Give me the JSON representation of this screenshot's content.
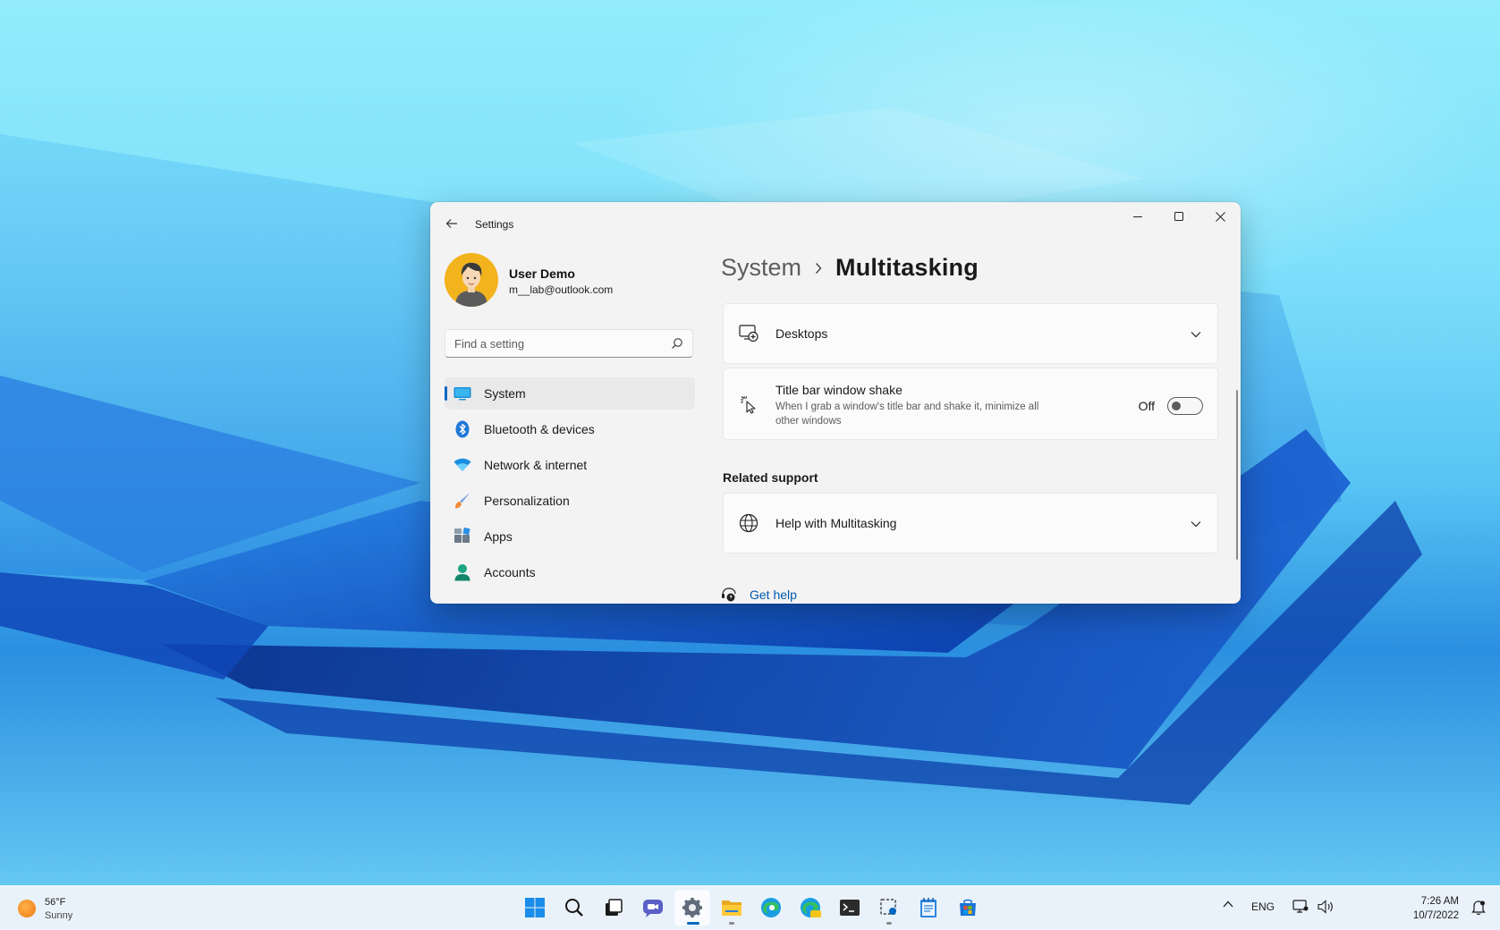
{
  "window": {
    "title": "Settings",
    "icons": {
      "back": "back-arrow-icon",
      "minimize": "minimize-icon",
      "maximize": "maximize-icon",
      "close": "close-icon"
    }
  },
  "profile": {
    "name": "User Demo",
    "email": "m__lab@outlook.com"
  },
  "search": {
    "placeholder": "Find a setting"
  },
  "nav": {
    "items": [
      {
        "label": "System",
        "icon": "system-icon",
        "active": true
      },
      {
        "label": "Bluetooth & devices",
        "icon": "bluetooth-icon"
      },
      {
        "label": "Network & internet",
        "icon": "wifi-icon"
      },
      {
        "label": "Personalization",
        "icon": "brush-icon"
      },
      {
        "label": "Apps",
        "icon": "apps-icon"
      },
      {
        "label": "Accounts",
        "icon": "accounts-icon"
      }
    ]
  },
  "content": {
    "breadcrumb": {
      "parent": "System",
      "current": "Multitasking"
    },
    "desktops": {
      "title": "Desktops"
    },
    "shake": {
      "title": "Title bar window shake",
      "description": "When I grab a window's title bar and shake it, minimize all other windows",
      "state_label": "Off",
      "enabled": false
    },
    "related_support": {
      "heading": "Related support",
      "help_title": "Help with Multitasking"
    },
    "get_help": "Get help"
  },
  "taskbar": {
    "weather": {
      "temp": "56°F",
      "condition": "Sunny"
    },
    "apps": [
      "start-icon",
      "search-icon",
      "task-view-icon",
      "chat-icon",
      "settings-icon",
      "file-explorer-icon",
      "edge-icon",
      "edge-canary-icon",
      "terminal-icon",
      "snipping-tool-icon",
      "notepad-icon",
      "store-icon"
    ],
    "tray": {
      "language": "ENG"
    },
    "clock": {
      "time": "7:26 AM",
      "date": "10/7/2022"
    }
  },
  "colors": {
    "accent": "#0067c0",
    "link": "#0058b0",
    "window_bg": "#f3f3f3",
    "card_bg": "#fbfbfb"
  }
}
